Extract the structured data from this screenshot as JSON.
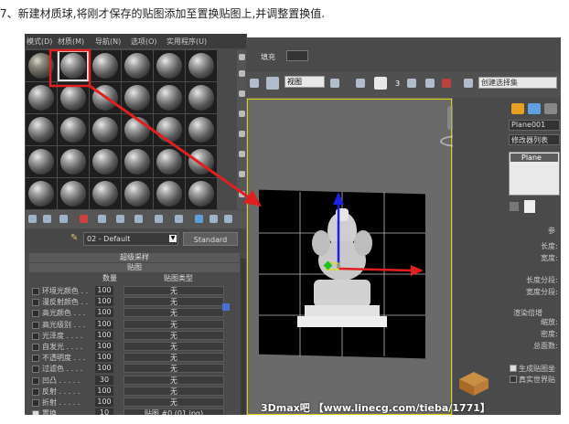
{
  "caption": "7、新建材质球,将刚才保存的贴图添加至置换贴图上,并调整置换值.",
  "material_editor": {
    "menu": [
      "模式(D)",
      "材质(M)",
      "导航(N)",
      "选项(O)",
      "实用程序(U)"
    ],
    "material_name": "02 - Default",
    "material_type_button": "Standard",
    "rollouts": {
      "supersampling": "超级采样",
      "maps": "贴图"
    },
    "maps_headers": {
      "amount": "数量",
      "map_type": "贴图类型"
    },
    "maps": [
      {
        "name": "环境光颜色 . .",
        "amount": "100",
        "map": "无",
        "checked": false
      },
      {
        "name": "漫反射颜色 . .",
        "amount": "100",
        "map": "无",
        "checked": false
      },
      {
        "name": "高光颜色 . . .",
        "amount": "100",
        "map": "无",
        "checked": false
      },
      {
        "name": "高光级别 . . .",
        "amount": "100",
        "map": "无",
        "checked": false
      },
      {
        "name": "光泽度 . . . .",
        "amount": "100",
        "map": "无",
        "checked": false
      },
      {
        "name": "自发光 . . . .",
        "amount": "100",
        "map": "无",
        "checked": false
      },
      {
        "name": "不透明度 . . .",
        "amount": "100",
        "map": "无",
        "checked": false
      },
      {
        "name": "过滤色 . . . .",
        "amount": "100",
        "map": "无",
        "checked": false
      },
      {
        "name": "凹凸 . . . . .",
        "amount": "30",
        "map": "无",
        "checked": false
      },
      {
        "name": "反射 . . . . .",
        "amount": "100",
        "map": "无",
        "checked": false
      },
      {
        "name": "折射 . . . . .",
        "amount": "100",
        "map": "无",
        "checked": false
      },
      {
        "name": "置换 . . . . .",
        "amount": "10",
        "map": "贴图 #0 (01.jpg)",
        "checked": true
      }
    ]
  },
  "viewport": {
    "fill_label": "填充",
    "view_dropdown": "视图",
    "snap_number": "3",
    "selection_set_placeholder": "创建选择集"
  },
  "command_panel": {
    "object_name": "Plane001",
    "modifier_list": "修改器列表",
    "stack_item": "Plane",
    "params_title": "参",
    "params": [
      "长度:",
      "宽度:",
      "长度分段:",
      "宽度分段:"
    ],
    "render_multipliers": "渲染倍增",
    "render_params": [
      "缩放:",
      "密度:",
      "总面数:"
    ],
    "checkboxes": [
      "生成贴图坐",
      "真实世界贴"
    ]
  },
  "watermark": "3Dmax吧 【www.linecg.com/tieba/1771】",
  "colors": {
    "arrow": "#e02020",
    "selection_outline": "#d8d000",
    "gizmo_y": "#2020e0",
    "gizmo_x": "#e02020"
  }
}
